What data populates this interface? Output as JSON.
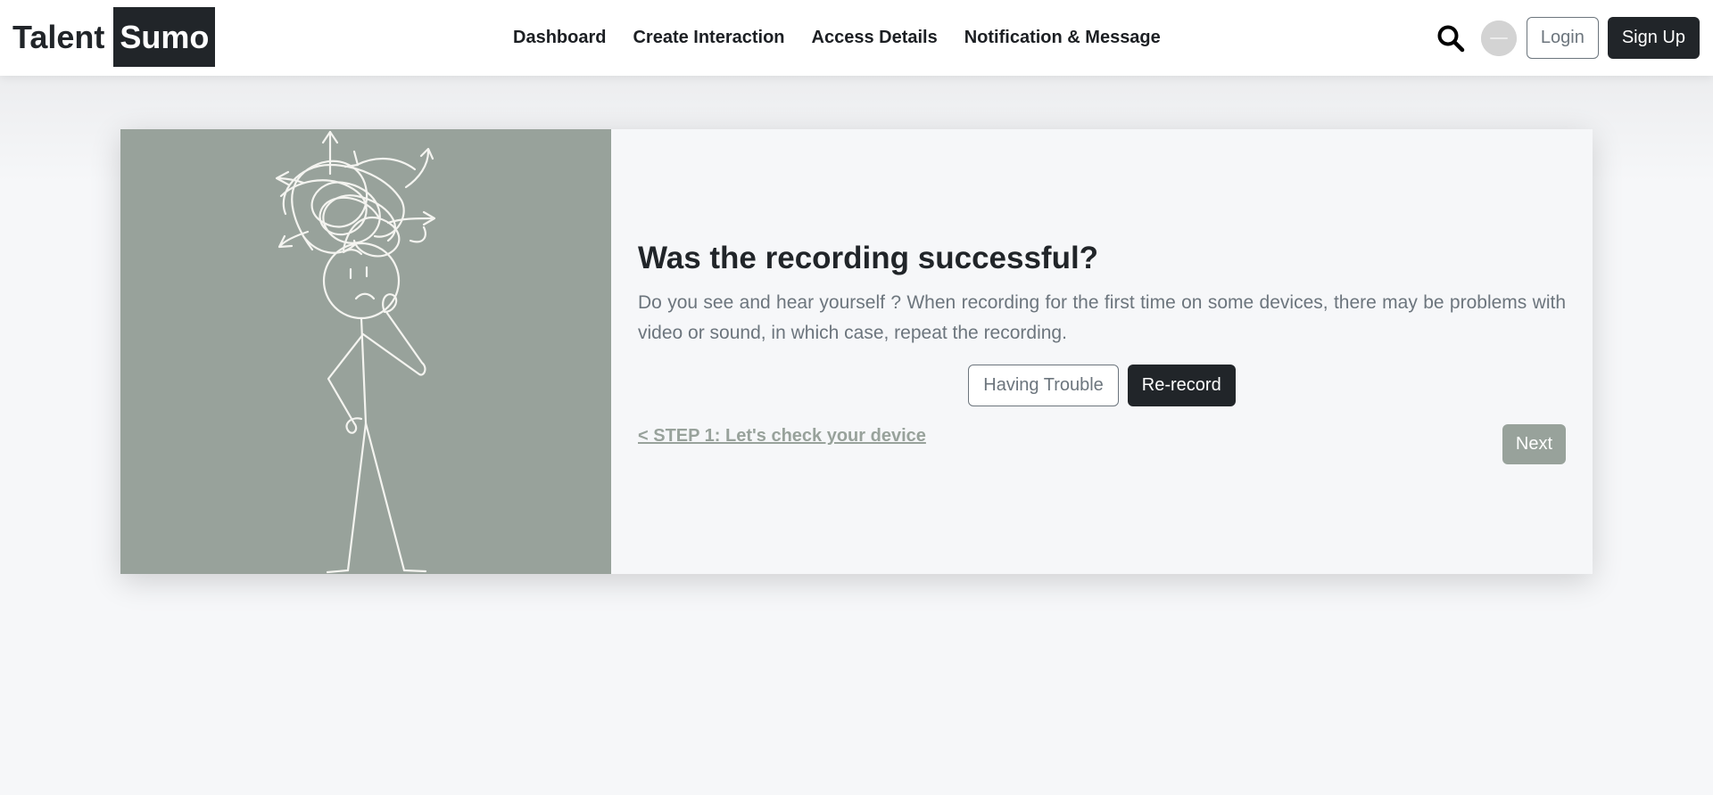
{
  "brand": {
    "part1": "Talent",
    "part2": "Sumo"
  },
  "nav": {
    "items": [
      {
        "label": "Dashboard"
      },
      {
        "label": "Create Interaction"
      },
      {
        "label": "Access Details"
      },
      {
        "label": "Notification & Message"
      }
    ]
  },
  "header": {
    "search_icon": "search-icon",
    "avatar_icon": "avatar",
    "login_label": "Login",
    "signup_label": "Sign Up"
  },
  "card": {
    "illustration": "confused-stick-figure",
    "title": "Was the recording successful?",
    "text": "Do you see and hear yourself ? When recording for the first time on some devices, there may be problems with video or sound, in which case, repeat the recording.",
    "having_trouble_label": "Having Trouble",
    "rerecord_label": "Re-record",
    "step_back_label": "< STEP 1: Let's check your device",
    "next_label": "Next"
  },
  "colors": {
    "primary_dark": "#212529",
    "accent_sage": "#98a29b",
    "muted_text": "#6c757d",
    "background": "#f6f7f9"
  }
}
